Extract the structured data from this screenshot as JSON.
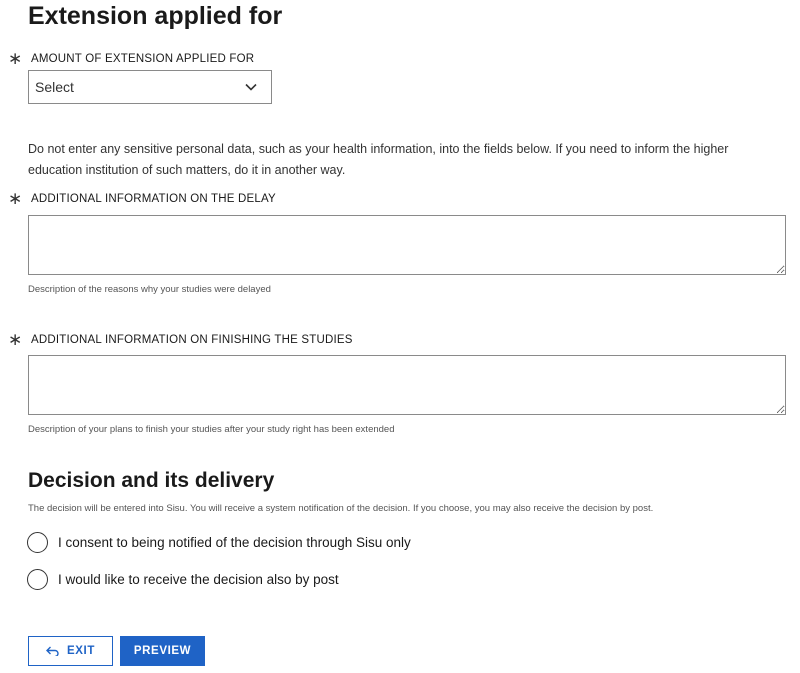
{
  "extension_section": {
    "title": "Extension applied for",
    "amount_label": "AMOUNT OF EXTENSION APPLIED FOR",
    "amount_select_value": "Select",
    "notice": "Do not enter any sensitive personal data, such as your health information, into the fields below. If you need to inform the higher education institution of such matters, do it in another way.",
    "delay_label": "ADDITIONAL INFORMATION ON THE DELAY",
    "delay_help": "Description of the reasons why your studies were delayed",
    "finish_label": "ADDITIONAL INFORMATION ON FINISHING THE STUDIES",
    "finish_help": "Description of your plans to finish your studies after your study right has been extended",
    "required_marker": "∗"
  },
  "decision_section": {
    "title": "Decision and its delivery",
    "description": "The decision will be entered into Sisu. You will receive a system notification of the decision. If you choose, you may also receive the decision by post.",
    "options": [
      {
        "label": "I consent to being notified of the decision through Sisu only",
        "selected": false
      },
      {
        "label": "I would like to receive the decision also by post",
        "selected": false
      }
    ]
  },
  "actions": {
    "exit_label": "EXIT",
    "preview_label": "PREVIEW"
  },
  "colors": {
    "primary": "#1f63c6",
    "text": "#1a1a1a",
    "border": "#8a8a8a"
  },
  "icons": {
    "required": "asterisk-icon",
    "select": "chevron-down-icon",
    "exit": "exit-arrow-icon"
  }
}
